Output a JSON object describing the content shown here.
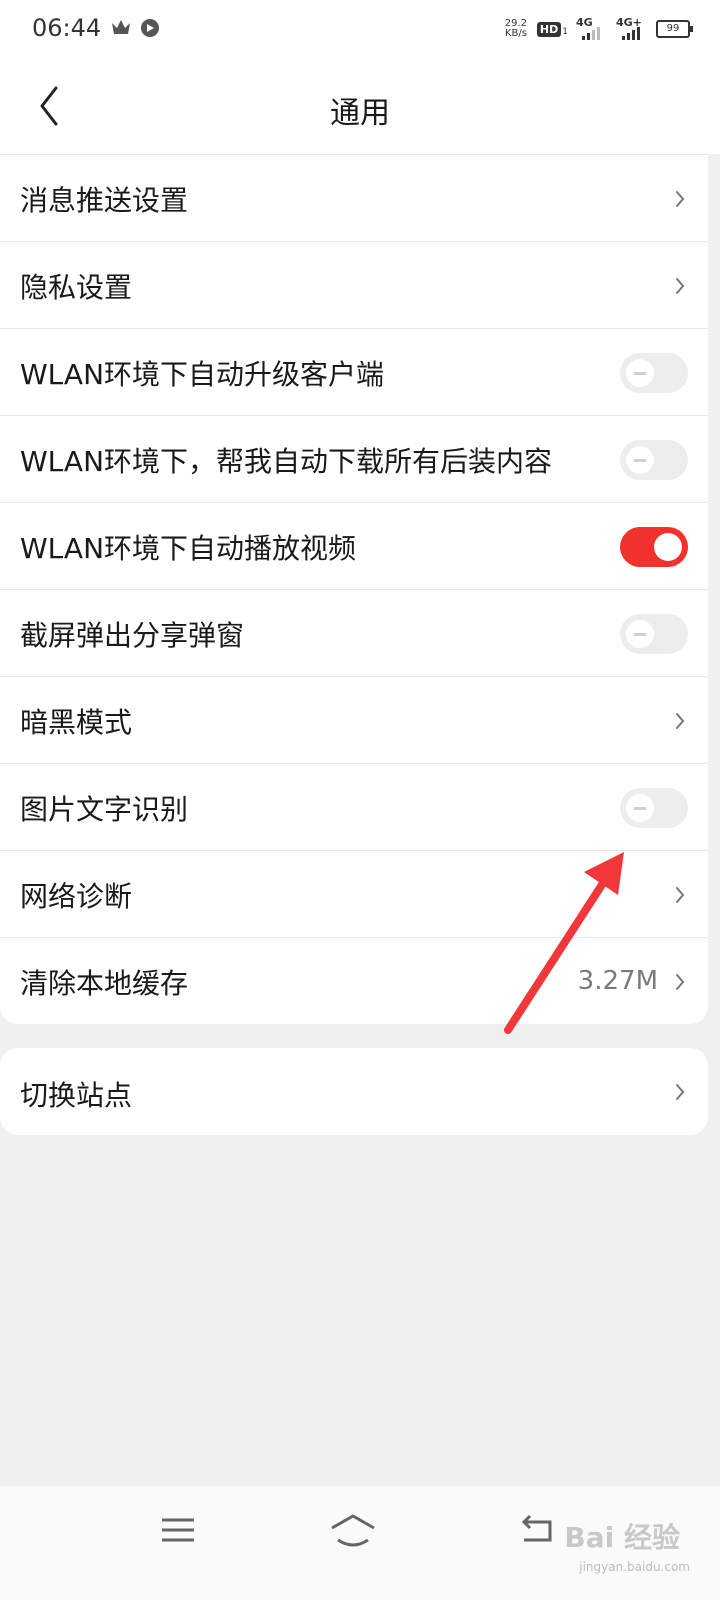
{
  "status_bar": {
    "time": "06:44",
    "speed_value": "29.2",
    "speed_unit": "KB/s",
    "hd_badge": "HD",
    "hd_sim": "1",
    "net1": "4G",
    "net2": "4G+",
    "battery": "99"
  },
  "header": {
    "title": "通用"
  },
  "settings": {
    "items": [
      {
        "label": "消息推送设置",
        "control": "chevron"
      },
      {
        "label": "隐私设置",
        "control": "chevron"
      },
      {
        "label": "WLAN环境下自动升级客户端",
        "control": "toggle",
        "on": false
      },
      {
        "label": "WLAN环境下，帮我自动下载所有后装内容",
        "control": "toggle",
        "on": false
      },
      {
        "label": "WLAN环境下自动播放视频",
        "control": "toggle",
        "on": true
      },
      {
        "label": "截屏弹出分享弹窗",
        "control": "toggle",
        "on": false
      },
      {
        "label": "暗黑模式",
        "control": "chevron"
      },
      {
        "label": "图片文字识别",
        "control": "toggle",
        "on": false
      },
      {
        "label": "网络诊断",
        "control": "chevron"
      },
      {
        "label": "清除本地缓存",
        "control": "chevron",
        "value": "3.27M"
      }
    ],
    "switch_site": {
      "label": "切换站点"
    }
  },
  "colors": {
    "toggle_on": "#f0312c",
    "toggle_off": "#ededed",
    "annotation_arrow": "#f2373a"
  },
  "watermark": {
    "text": "Bai 经验",
    "sub": "jingyan.baidu.com"
  }
}
